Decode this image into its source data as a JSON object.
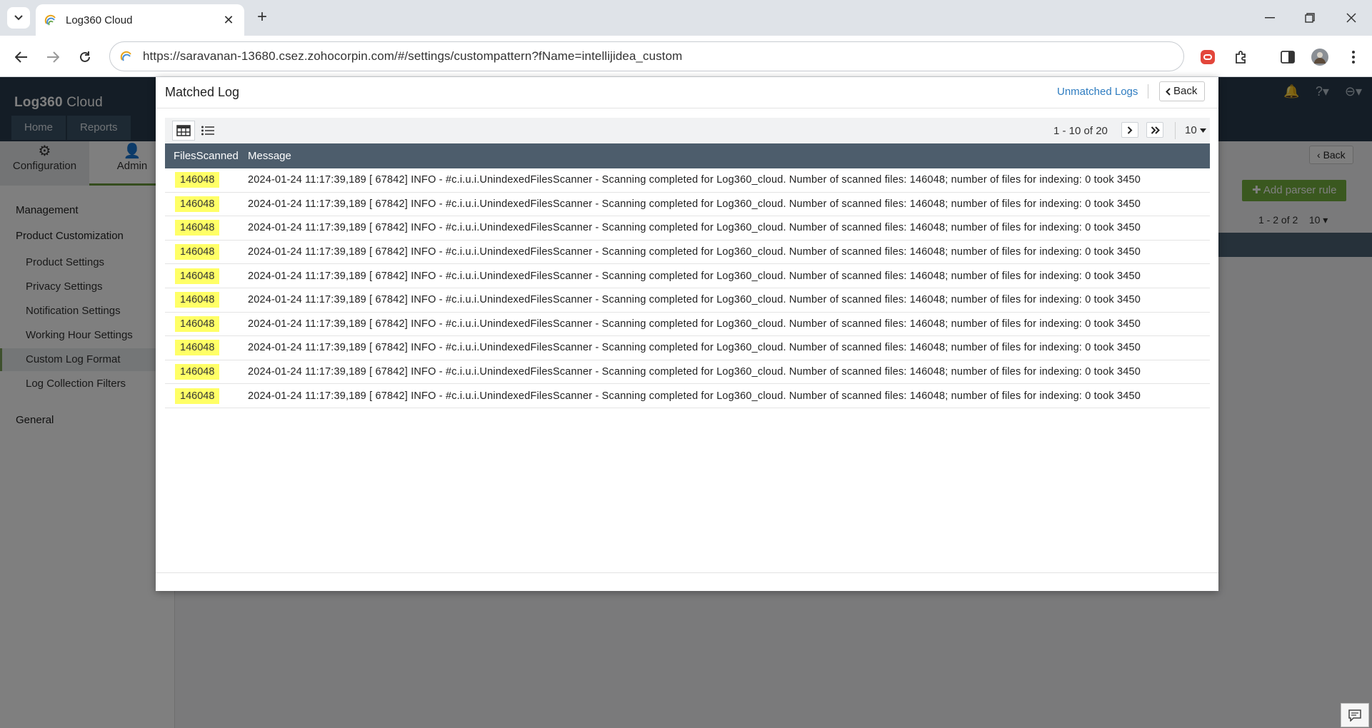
{
  "browser": {
    "tab_title": "Log360 Cloud",
    "url": "https://saravanan-13680.csez.zohocorpin.com/#/settings/custompattern?fName=intellijidea_custom"
  },
  "app": {
    "logo": "Log360",
    "logo_suffix": "Cloud",
    "topnav": [
      "Home",
      "Reports"
    ],
    "subtabs": [
      {
        "label": "Configuration",
        "icon": "gear-icon"
      },
      {
        "label": "Admin",
        "icon": "user-icon"
      }
    ],
    "sidebar": {
      "sections": [
        {
          "label": "Management"
        },
        {
          "label": "Product Customization"
        },
        {
          "label": "General"
        }
      ],
      "items": [
        {
          "label": "Product Settings"
        },
        {
          "label": "Privacy Settings"
        },
        {
          "label": "Notification Settings"
        },
        {
          "label": "Working Hour Settings"
        },
        {
          "label": "Custom Log Format"
        },
        {
          "label": "Log Collection Filters"
        }
      ]
    },
    "background": {
      "back_label": "Back",
      "add_parser_label": "Add parser rule",
      "pagination": "1 - 2 of 2",
      "page_size": "10"
    }
  },
  "modal": {
    "title": "Matched Log",
    "unmatched_link": "Unmatched Logs",
    "back_label": "Back",
    "pagination": "1 - 10 of 20",
    "page_size": "10",
    "columns": [
      "FilesScanned",
      "Message"
    ],
    "rows": [
      {
        "files": "146048",
        "message": "2024-01-24 11:17:39,189 [ 67842] INFO - #c.i.u.i.UnindexedFilesScanner - Scanning completed for Log360_cloud. Number of scanned files: 146048; number of files for indexing: 0 took 3450"
      },
      {
        "files": "146048",
        "message": "2024-01-24 11:17:39,189 [ 67842] INFO - #c.i.u.i.UnindexedFilesScanner - Scanning completed for Log360_cloud. Number of scanned files: 146048; number of files for indexing: 0 took 3450"
      },
      {
        "files": "146048",
        "message": "2024-01-24 11:17:39,189 [ 67842] INFO - #c.i.u.i.UnindexedFilesScanner - Scanning completed for Log360_cloud. Number of scanned files: 146048; number of files for indexing: 0 took 3450"
      },
      {
        "files": "146048",
        "message": "2024-01-24 11:17:39,189 [ 67842] INFO - #c.i.u.i.UnindexedFilesScanner - Scanning completed for Log360_cloud. Number of scanned files: 146048; number of files for indexing: 0 took 3450"
      },
      {
        "files": "146048",
        "message": "2024-01-24 11:17:39,189 [ 67842] INFO - #c.i.u.i.UnindexedFilesScanner - Scanning completed for Log360_cloud. Number of scanned files: 146048; number of files for indexing: 0 took 3450"
      },
      {
        "files": "146048",
        "message": "2024-01-24 11:17:39,189 [ 67842] INFO - #c.i.u.i.UnindexedFilesScanner - Scanning completed for Log360_cloud. Number of scanned files: 146048; number of files for indexing: 0 took 3450"
      },
      {
        "files": "146048",
        "message": "2024-01-24 11:17:39,189 [ 67842] INFO - #c.i.u.i.UnindexedFilesScanner - Scanning completed for Log360_cloud. Number of scanned files: 146048; number of files for indexing: 0 took 3450"
      },
      {
        "files": "146048",
        "message": "2024-01-24 11:17:39,189 [ 67842] INFO - #c.i.u.i.UnindexedFilesScanner - Scanning completed for Log360_cloud. Number of scanned files: 146048; number of files for indexing: 0 took 3450"
      },
      {
        "files": "146048",
        "message": "2024-01-24 11:17:39,189 [ 67842] INFO - #c.i.u.i.UnindexedFilesScanner - Scanning completed for Log360_cloud. Number of scanned files: 146048; number of files for indexing: 0 took 3450"
      },
      {
        "files": "146048",
        "message": "2024-01-24 11:17:39,189 [ 67842] INFO - #c.i.u.i.UnindexedFilesScanner - Scanning completed for Log360_cloud. Number of scanned files: 146048; number of files for indexing: 0 took 3450"
      }
    ]
  },
  "colors": {
    "accent_green": "#74b03e",
    "header_dark": "#283b4c",
    "grid_header": "#4d5d6c",
    "badge_yellow": "#ffff66",
    "link_blue": "#2e7cc0"
  }
}
